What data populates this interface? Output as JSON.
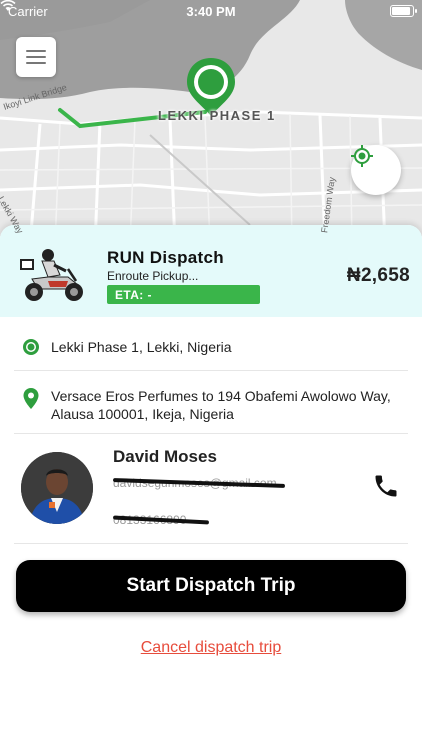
{
  "status_bar": {
    "carrier": "Carrier",
    "time": "3:40 PM"
  },
  "map": {
    "location_label": "LEKKI PHASE 1",
    "streets": [
      "Ikoyi Link Bridge",
      "Freedom Way",
      "Lekki Way"
    ],
    "route_color": "#3ab54a",
    "water_color": "#9e9e9e",
    "marker_color": "#2e9e3e",
    "menu_icon": "hamburger-menu-icon",
    "locate_icon": "my-location-icon"
  },
  "dispatch": {
    "title": "RUN Dispatch",
    "status": "Enroute Pickup...",
    "eta": "ETA: -",
    "price": "₦2,658",
    "card_color": "#e4fafa"
  },
  "pickup": {
    "address": "Lekki Phase 1, Lekki, Nigeria",
    "icon": "pickup-pin-icon"
  },
  "dropoff": {
    "address": "Versace Eros Perfumes to 194 Obafemi Awolowo Way, Alausa 100001, Ikeja, Nigeria",
    "icon": "location-pin-icon"
  },
  "contact": {
    "name": "David Moses",
    "email": "davidsegunmoses@gmail.com",
    "phone": "08133166890",
    "call_icon": "phone-icon"
  },
  "actions": {
    "start_label": "Start Dispatch Trip",
    "cancel_label": "Cancel dispatch trip",
    "cancel_color": "#e74c3c"
  }
}
